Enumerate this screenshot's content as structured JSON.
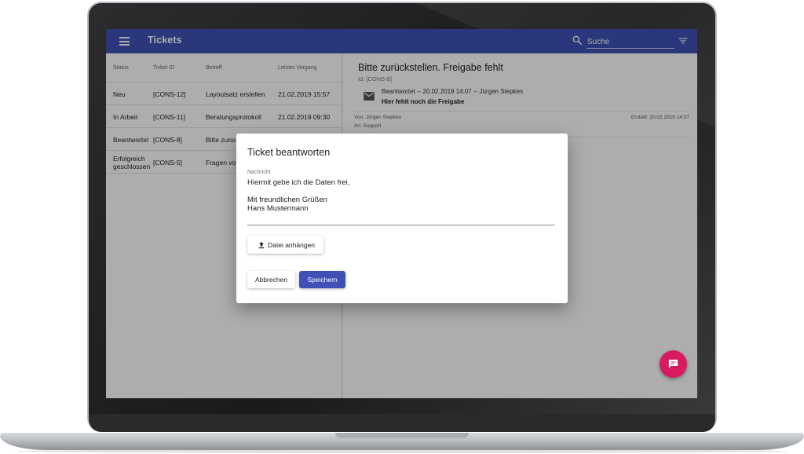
{
  "app": {
    "title": "Tickets",
    "accent": "#3f51b5",
    "fab_color": "#d81b60"
  },
  "search": {
    "placeholder": "Suche"
  },
  "icons": {
    "menu": "menu-icon",
    "search": "search-icon",
    "filter": "filter-icon",
    "mail": "mail-icon",
    "upload": "upload-icon",
    "chat": "chat-icon"
  },
  "table": {
    "columns": [
      "Status",
      "Ticket ID",
      "Betreff",
      "Letzter Vorgang"
    ],
    "rows": [
      {
        "status": "Neu",
        "id": "[CONS-12]",
        "subject": "Layoutsatz erstellen",
        "date": "21.02.2019 15:57"
      },
      {
        "status": "In Arbeit",
        "id": "[CONS-11]",
        "subject": "Beratungsprotokoll",
        "date": "21.02.2019 09:30"
      },
      {
        "status": "Beantwortet",
        "id": "[CONS-8]",
        "subject": "Bitte zurückstellen. Freigabe fehlt",
        "date": ""
      },
      {
        "status_line1": "Erfolgreich",
        "status_line2": "geschlossen",
        "id": "[CONS-5]",
        "subject": "Fragen vorab",
        "date": ""
      }
    ]
  },
  "detail": {
    "title": "Bitte zurückstellen. Freigabe fehlt",
    "id": "Id: [CONS-8]",
    "message": {
      "meta": "Beantwortet -- 20.02.2019 14:07 -- Jürgen Stepkes",
      "subject": "Hier fehlt noch die Freigabe",
      "from": "Von: Jürgen Stepkes",
      "to": "An: Support",
      "created": "Erstellt: 20.02.2019 14:07"
    }
  },
  "dialog": {
    "title": "Ticket beantworten",
    "field_label": "Nachricht",
    "field_value": "Hiermit gebe ich die Daten frei,\n\nMit freundlichen Grüßen\nHans Mustermann",
    "attach_label": "Datei anhängen",
    "cancel_label": "Abbrechen",
    "save_label": "Speichern"
  }
}
